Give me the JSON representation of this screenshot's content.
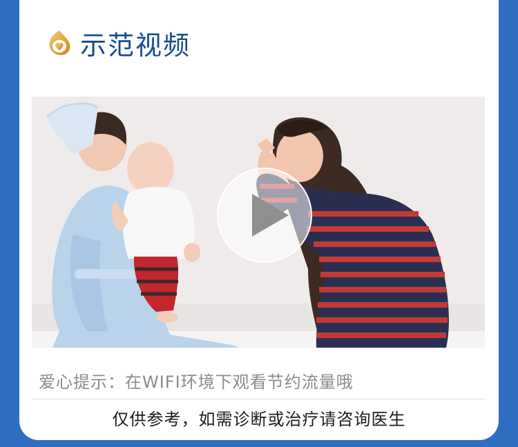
{
  "header": {
    "title": "示范视频",
    "logo_icon": "heart-ring-logo-icon",
    "accent_color": "#184b8f",
    "logo_gold_color": "#d8a640"
  },
  "video": {
    "play_icon": "play-icon",
    "scene": "nurse-baby-mother-photo"
  },
  "tip": {
    "text": "爱心提示：在WIFI环境下观看节约流量哦"
  },
  "footer": {
    "disclaimer": "仅供参考，如需诊断或治疗请咨询医生"
  },
  "colors": {
    "page_background": "#2f6ec1",
    "card_background": "#ffffff",
    "tip_text": "#8b8b8b",
    "disclaimer_text": "#1d1d1d"
  }
}
